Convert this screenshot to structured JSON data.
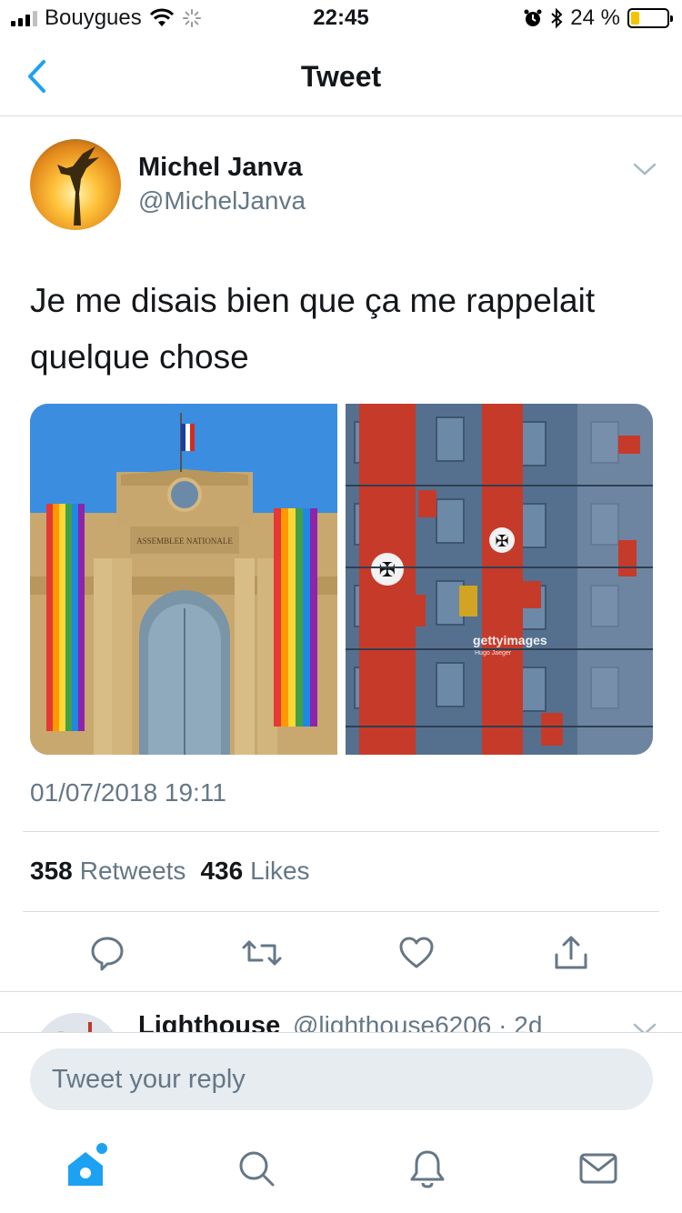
{
  "status_bar": {
    "carrier": "Bouygues",
    "time": "22:45",
    "battery_percent": "24 %",
    "battery_level": 0.24,
    "battery_color": "#f5c400"
  },
  "nav": {
    "title": "Tweet",
    "back_icon": "chevron-left-icon"
  },
  "tweet": {
    "author_name": "Michel Janva",
    "author_handle": "@MichelJanva",
    "text": "Je me disais bien que ça me rappelait quelque chose",
    "date": "01/07/2018 19:11",
    "retweets_count": "358",
    "retweets_label": "Retweets",
    "likes_count": "436",
    "likes_label": "Likes",
    "media_watermark": "gettyimages",
    "media_watermark_credit": "Hugo Jaeger",
    "media_caption_building": "ASSEMBLEE NATIONALE"
  },
  "actions": [
    "reply-icon",
    "retweet-icon",
    "like-icon",
    "share-icon"
  ],
  "reply_preview": {
    "name": "Lighthouse",
    "meta": "@lighthouse6206 · 2d"
  },
  "reply_bar": {
    "placeholder": "Tweet your reply"
  },
  "tab_bar": [
    "home-icon",
    "search-icon",
    "notifications-icon",
    "messages-icon"
  ],
  "colors": {
    "accent": "#1da1f2",
    "secondary_text": "#657786",
    "divider": "#d8dde1"
  }
}
